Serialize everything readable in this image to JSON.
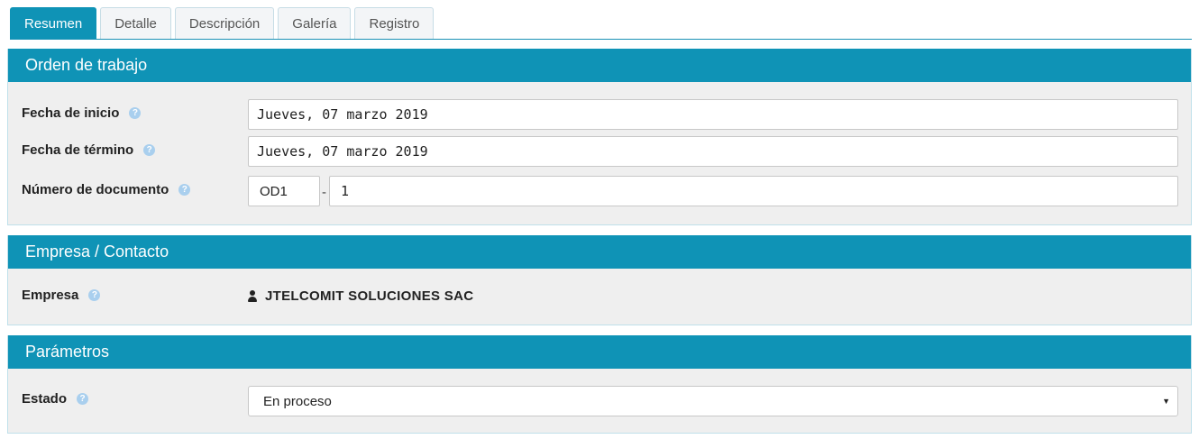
{
  "tabs": [
    {
      "label": "Resumen",
      "active": true
    },
    {
      "label": "Detalle",
      "active": false
    },
    {
      "label": "Descripción",
      "active": false
    },
    {
      "label": "Galería",
      "active": false
    },
    {
      "label": "Registro",
      "active": false
    }
  ],
  "orden": {
    "title": "Orden de trabajo",
    "fecha_inicio": {
      "label": "Fecha de inicio",
      "value": "Jueves, 07 marzo 2019"
    },
    "fecha_termino": {
      "label": "Fecha de término",
      "value": "Jueves, 07 marzo 2019"
    },
    "numero_documento": {
      "label": "Número de documento",
      "serie": "OD1",
      "separator": "-",
      "numero": "1"
    }
  },
  "empresa": {
    "title": "Empresa / Contacto",
    "label": "Empresa",
    "value": "JTELCOMIT SOLUCIONES SAC"
  },
  "parametros": {
    "title": "Parámetros",
    "estado": {
      "label": "Estado",
      "value": "En proceso"
    }
  },
  "icons": {
    "help": "question-circle-icon",
    "user": "user-icon",
    "dropdown": "caret-down-icon"
  },
  "colors": {
    "accent": "#0f93b6",
    "panel_bg": "#efefef",
    "help_icon": "#a9cfee"
  }
}
